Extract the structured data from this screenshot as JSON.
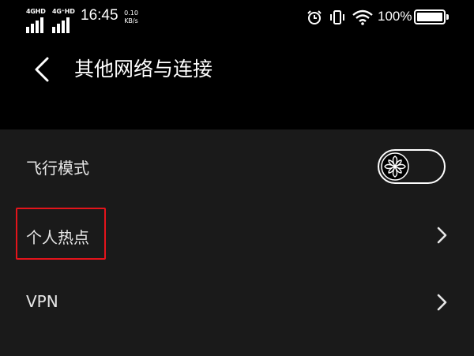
{
  "status_bar": {
    "sim1_network": "4GHD",
    "sim2_network": "4G⁺HD",
    "time": "16:45",
    "net_speed_value": "0.10",
    "net_speed_unit": "KB/s",
    "battery_percent": "100%",
    "battery_level": 1.0,
    "icons": [
      "alarm-icon",
      "vibrate-icon",
      "wifi-icon",
      "battery-icon"
    ]
  },
  "header": {
    "title": "其他网络与连接",
    "back_icon": "chevron-left-icon"
  },
  "settings": {
    "items": [
      {
        "label": "飞行模式",
        "control": "toggle",
        "toggle_on": false
      },
      {
        "label": "个人热点",
        "control": "chevron",
        "highlighted": true
      },
      {
        "label": "VPN",
        "control": "chevron"
      }
    ]
  },
  "colors": {
    "background": "#000000",
    "list_background": "#1a1a1a",
    "text": "#e6e6e6",
    "highlight": "#e4141b"
  }
}
